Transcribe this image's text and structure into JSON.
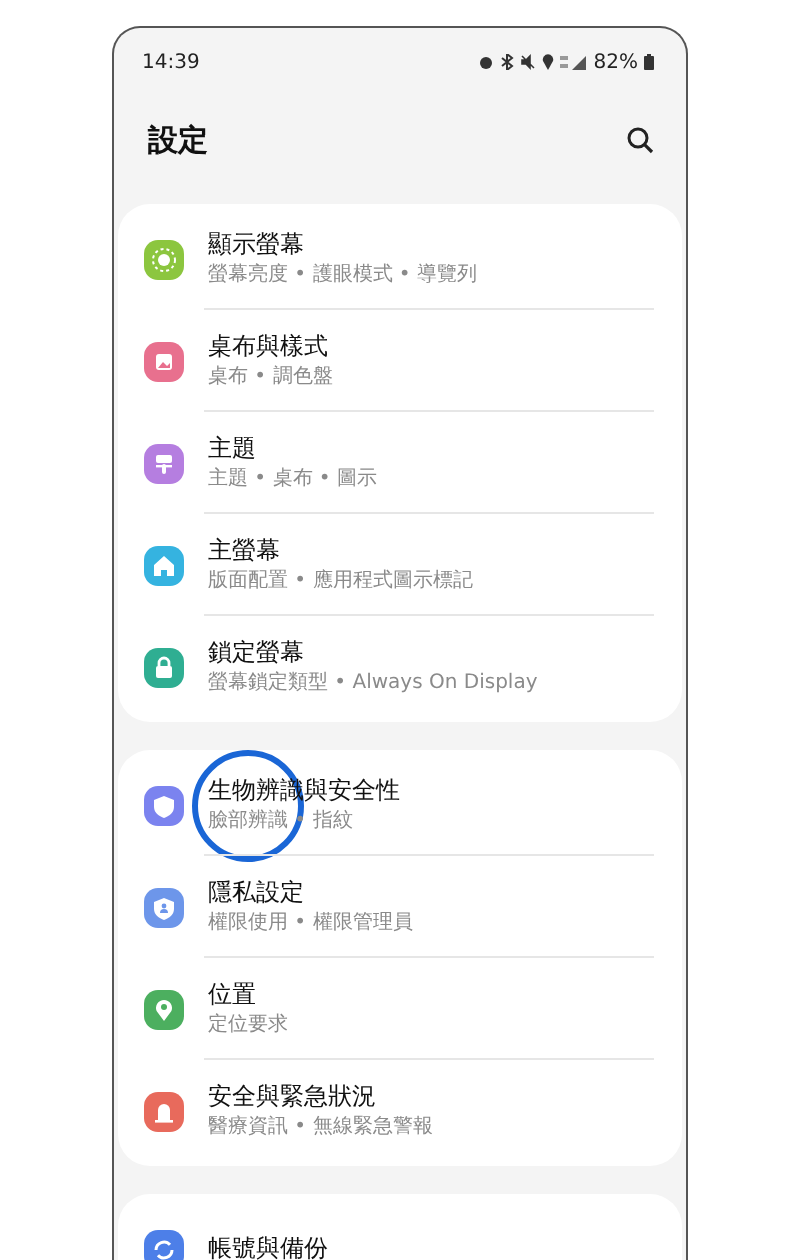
{
  "status_bar": {
    "time": "14:39",
    "battery": "82%"
  },
  "header": {
    "title": "設定"
  },
  "groups": [
    {
      "items": [
        {
          "title": "顯示螢幕",
          "subtitle": "螢幕亮度 • 護眼模式 • 導覽列",
          "color": "#8cc63f",
          "highlighted": false
        },
        {
          "title": "桌布與樣式",
          "subtitle": "桌布 • 調色盤",
          "color": "#e8708e",
          "highlighted": false
        },
        {
          "title": "主題",
          "subtitle": "主題 • 桌布 • 圖示",
          "color": "#b57ee0",
          "highlighted": false
        },
        {
          "title": "主螢幕",
          "subtitle": "版面配置 • 應用程式圖示標記",
          "color": "#35b3e0",
          "highlighted": false
        },
        {
          "title": "鎖定螢幕",
          "subtitle": "螢幕鎖定類型 • Always On Display",
          "color": "#2fae92",
          "highlighted": false
        }
      ]
    },
    {
      "items": [
        {
          "title": "生物辨識與安全性",
          "subtitle": "臉部辨識 • 指紋",
          "color": "#7b83ef",
          "highlighted": true
        },
        {
          "title": "隱私設定",
          "subtitle": "權限使用 • 權限管理員",
          "color": "#6d96ea",
          "highlighted": false
        },
        {
          "title": "位置",
          "subtitle": "定位要求",
          "color": "#4caf5f",
          "highlighted": false
        },
        {
          "title": "安全與緊急狀況",
          "subtitle": "醫療資訊 • 無線緊急警報",
          "color": "#e86a5c",
          "highlighted": false
        }
      ]
    },
    {
      "items": [
        {
          "title": "帳號與備份",
          "color": "#4d7fe8",
          "highlighted": false
        }
      ]
    }
  ]
}
